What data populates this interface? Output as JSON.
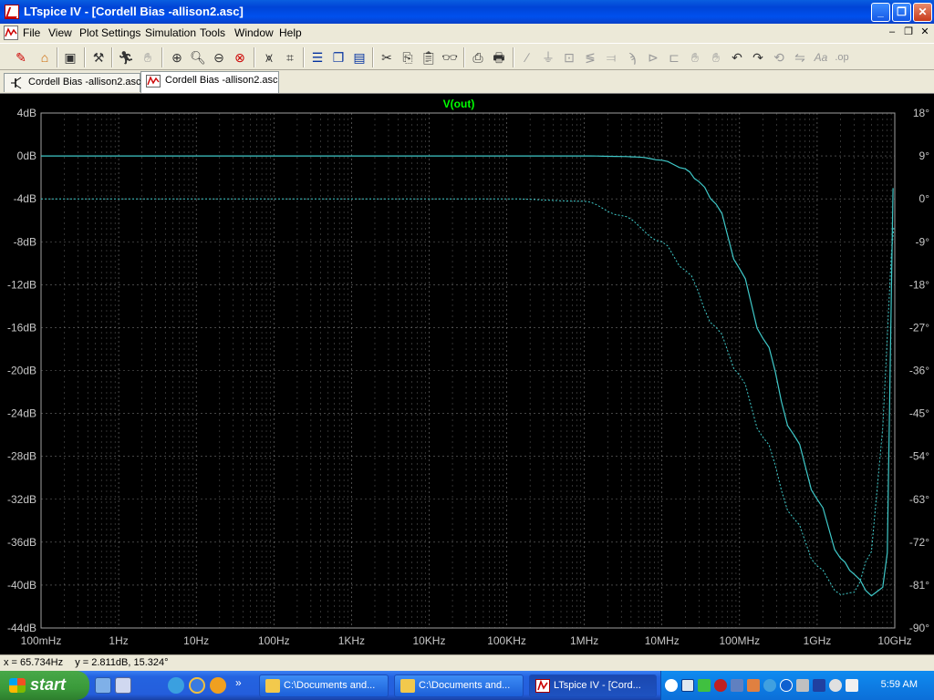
{
  "window": {
    "title": "LTspice IV - [Cordell Bias -allison2.asc]",
    "buttons": {
      "minimize": "_",
      "maximize": "❐",
      "close": "✕"
    }
  },
  "menu": {
    "items": [
      "File",
      "View",
      "Plot Settings",
      "Simulation",
      "Tools",
      "Window",
      "Help"
    ],
    "mdi_buttons": {
      "minimize": "–",
      "restore": "❐",
      "close": "✕"
    }
  },
  "tabs": [
    {
      "label": "Cordell Bias -allison2.asc",
      "icon": "schematic-icon",
      "active": false
    },
    {
      "label": "Cordell Bias -allison2.asc",
      "icon": "waveform-icon",
      "active": true
    }
  ],
  "plot": {
    "trace_name": "V(out)",
    "colors": {
      "background": "#000000",
      "grid": "#8a8a8a",
      "trace": "#3fc9c9",
      "trace_label": "#00ff00",
      "axis_text": "#c8c8c8"
    }
  },
  "chart_data": {
    "type": "line",
    "title": "V(out)",
    "x_scale": "log",
    "xlim": [
      0.1,
      10000000000
    ],
    "ylim": [
      -44,
      4
    ],
    "y2lim": [
      -90,
      18
    ],
    "x_ticks": [
      "100mHz",
      "1Hz",
      "10Hz",
      "100Hz",
      "1KHz",
      "10KHz",
      "100KHz",
      "1MHz",
      "10MHz",
      "100MHz",
      "1GHz",
      "10GHz"
    ],
    "y_ticks": [
      "4dB",
      "0dB",
      "-4dB",
      "-8dB",
      "-12dB",
      "-16dB",
      "-20dB",
      "-24dB",
      "-28dB",
      "-32dB",
      "-36dB",
      "-40dB",
      "-44dB"
    ],
    "y2_ticks": [
      "18°",
      "9°",
      "0°",
      "-9°",
      "-18°",
      "-27°",
      "-36°",
      "-45°",
      "-54°",
      "-63°",
      "-72°",
      "-81°",
      "-90°"
    ],
    "grid": true,
    "series": [
      {
        "name": "V(out)",
        "axis": "left",
        "style": "solid",
        "x": [
          0.1,
          1000000,
          3000000,
          5000000,
          10000000,
          20000000,
          30000000,
          50000000,
          100000000,
          200000000,
          500000000,
          1000000000,
          2000000000,
          3000000000,
          5000000000,
          7000000000,
          8000000000,
          9500000000
        ],
        "y": [
          0,
          0,
          -0.05,
          -0.1,
          -0.4,
          -1.2,
          -2.4,
          -4.5,
          -10.5,
          -17,
          -26,
          -32,
          -37.5,
          -39,
          -41,
          -40.2,
          -37,
          -3
        ]
      },
      {
        "name": "V(out) phase",
        "axis": "right",
        "style": "dashed",
        "x": [
          0.1,
          100000,
          1000000,
          3000000,
          10000000,
          20000000,
          50000000,
          100000000,
          200000000,
          500000000,
          1000000000,
          2000000000,
          3000000000,
          5000000000,
          7000000000,
          9000000000,
          9700000000
        ],
        "y": [
          0,
          0,
          -0.5,
          -3.5,
          -9,
          -15,
          -27,
          -37,
          -50,
          -67,
          -77,
          -83,
          -82.5,
          -74,
          -48,
          -12,
          -6
        ]
      }
    ]
  },
  "status": {
    "x": "x = 65.734Hz",
    "y": "y = 2.811dB, 15.324°"
  },
  "taskbar": {
    "start_label": "start",
    "tasks": [
      {
        "label": "C:\\Documents and...",
        "icon": "folder-icon"
      },
      {
        "label": "C:\\Documents and...",
        "icon": "folder-icon"
      },
      {
        "label": "LTspice IV - [Cord...",
        "icon": "ltspice-icon"
      }
    ],
    "clock": "5:59 AM"
  }
}
